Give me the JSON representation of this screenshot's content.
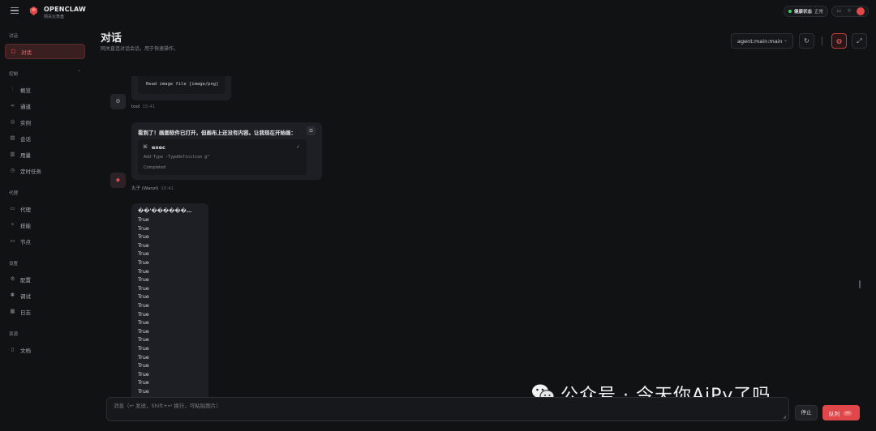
{
  "brand": {
    "name": "OPENCLAW",
    "subtitle": "网关仪表盘"
  },
  "topbar": {
    "health_label": "健康状态",
    "health_value": "正常"
  },
  "sidebar": {
    "sections": [
      {
        "title": "对话",
        "items": [
          {
            "label": "对话",
            "icon": "chat-icon",
            "active": true
          }
        ]
      },
      {
        "title": "控制",
        "items": [
          {
            "label": "概览",
            "icon": "bar-chart-icon"
          },
          {
            "label": "通道",
            "icon": "link-icon"
          },
          {
            "label": "实例",
            "icon": "signal-icon"
          },
          {
            "label": "会话",
            "icon": "document-icon"
          },
          {
            "label": "用量",
            "icon": "usage-icon"
          },
          {
            "label": "定时任务",
            "icon": "clock-icon"
          }
        ]
      },
      {
        "title": "代理",
        "items": [
          {
            "label": "代理",
            "icon": "folder-icon"
          },
          {
            "label": "技能",
            "icon": "sparkle-icon"
          },
          {
            "label": "节点",
            "icon": "monitor-icon"
          }
        ]
      },
      {
        "title": "设置",
        "items": [
          {
            "label": "配置",
            "icon": "gear-icon"
          },
          {
            "label": "调试",
            "icon": "bug-icon"
          },
          {
            "label": "日志",
            "icon": "log-icon"
          }
        ]
      },
      {
        "title": "资源",
        "items": [
          {
            "label": "文档",
            "icon": "book-icon"
          }
        ]
      }
    ]
  },
  "header": {
    "title": "对话",
    "subtitle": "网关直连对话会话，用于快速操作。",
    "agent": "agent:main:main"
  },
  "messages": {
    "tool_card_text": "Read image file [image/png]",
    "tool_sender": "tool",
    "tool_time": "15:41",
    "assistant_text": "看到了！画图软件已打开，但画布上还没有内容。让我现在开始画：",
    "exec_title": "exec",
    "exec_detail": "Add-Type -TypeDefinition @\"",
    "exec_status": "Completed",
    "assistant_sender": "丸子 (Wanzi)",
    "assistant_time": "15:41",
    "output_header": "��'������…",
    "output_lines": [
      "True",
      "True",
      "True",
      "True",
      "True",
      "True",
      "True",
      "True",
      "True",
      "True",
      "True",
      "True",
      "True",
      "True",
      "True",
      "True",
      "True",
      "True",
      "True",
      "True",
      "True",
      "True"
    ]
  },
  "composer": {
    "placeholder": "消息（↩ 发送，Shift+↩ 换行，可粘贴图片）",
    "stop_label": "停止",
    "queue_label": "队列",
    "queue_kbd": "↩"
  },
  "watermark": {
    "text": "公众号 · 今天你AiPy了吗"
  },
  "colors": {
    "accent": "#e0474a",
    "background": "#111214",
    "health": "#3fd06a"
  }
}
